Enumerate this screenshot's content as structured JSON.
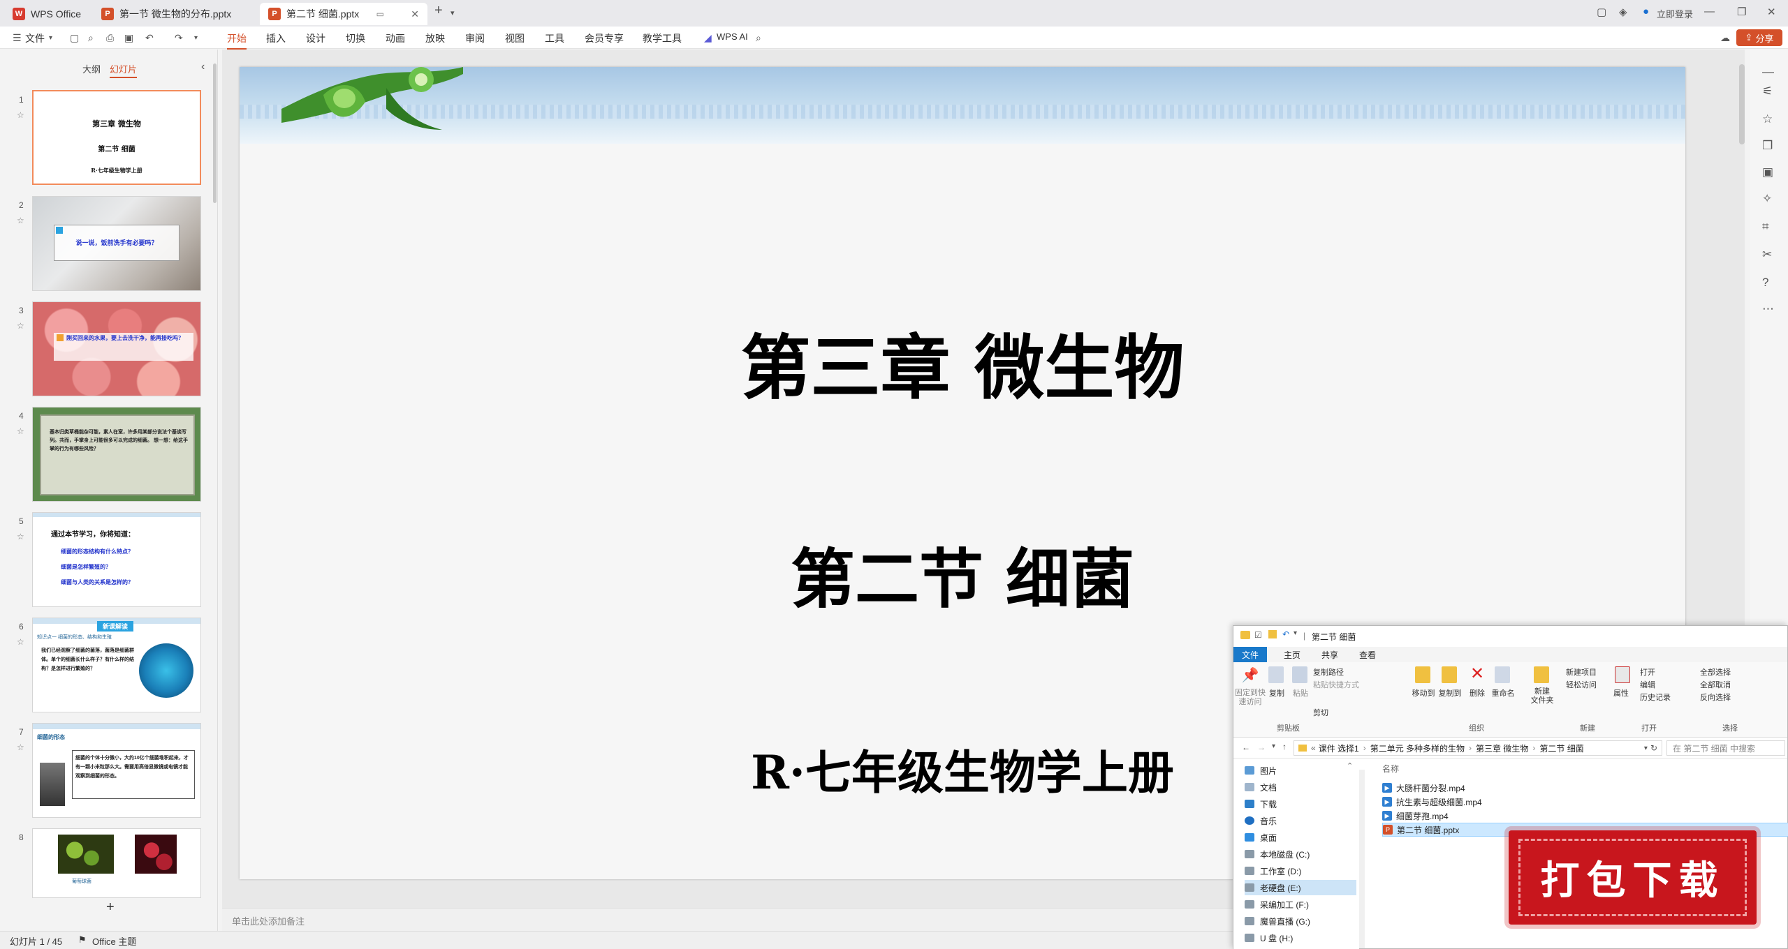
{
  "titlebar": {
    "tabs": [
      {
        "label": "WPS Office",
        "icon": "wps-logo-icon"
      },
      {
        "label": "第一节 微生物的分布.pptx",
        "icon": "pptx-icon"
      },
      {
        "label": "第二节 细菌.pptx",
        "icon": "pptx-icon"
      }
    ],
    "login": "立即登录"
  },
  "ribbon": {
    "file": "文件",
    "tabs": [
      "开始",
      "插入",
      "设计",
      "切换",
      "动画",
      "放映",
      "审阅",
      "视图",
      "工具",
      "会员专享",
      "教学工具"
    ],
    "ai": "WPS AI",
    "share": "分享"
  },
  "leftpanel": {
    "tab_outline": "大纲",
    "tab_slides": "幻灯片",
    "slides": [
      {
        "num": "1",
        "line1": "第三章  微生物",
        "line2": "第二节  细菌",
        "line3": "R·七年级生物学上册"
      },
      {
        "num": "2",
        "caption": "说一说，饭前洗手有必要吗？"
      },
      {
        "num": "3",
        "caption": "刚买回来的水果，要上去洗干净，能再接吃吗？"
      },
      {
        "num": "4",
        "caption": "基本归类草桶能杂可能，素人在室，许多用某部分说法个基谈写列。共而，手掌身上可能很多可以完成的细菌。 想一想：给这手掌的行为有哪些风险？"
      },
      {
        "num": "5",
        "heading": "通过本节学习，你将知道：",
        "items": [
          "细菌的形态结构有什么特点？",
          "细菌是怎样繁殖的？",
          "细菌与人类的关系是怎样的？"
        ]
      },
      {
        "num": "6",
        "banner": "新课解读",
        "subhead": "知识点一  细菌的形态、结构和生殖",
        "body": "我们已经观察了细菌的菌落，菌落是细菌群体。单个的细菌长什么样子？有什么样的结构？是怎样进行繁殖的？"
      },
      {
        "num": "7",
        "subhead": "细菌的形态",
        "body": "细菌的个体十分微小，大约10亿个细菌堆积起来，才有一颗小米粒那么大。需要用高倍显微镜或电镜才能观察到细菌的形态。"
      },
      {
        "num": "8",
        "caption": "葡萄球菌"
      }
    ],
    "add": "+"
  },
  "slide": {
    "title": "第三章  微生物",
    "subtitle": "第二节  细菌",
    "footer": "R·七年级生物学上册"
  },
  "notes": {
    "placeholder": "单击此处添加备注"
  },
  "status": {
    "slide_counter": "幻灯片 1 / 45",
    "theme": "Office 主题"
  },
  "explorer": {
    "title": "第二节 细菌",
    "tabs": [
      "文件",
      "主页",
      "共享",
      "查看"
    ],
    "ribbon": {
      "pin": "固定到快速访问",
      "copy": "复制",
      "paste": "粘贴",
      "copy_path": "复制路径",
      "paste_shortcut": "粘贴快捷方式",
      "cut": "剪切",
      "clipboard": "剪贴板",
      "move_to": "移动到",
      "copy_to": "复制到",
      "delete": "删除",
      "rename": "重命名",
      "organize": "组织",
      "new_folder": "新建\n文件夹",
      "new_item": "新建项目",
      "easy_access": "轻松访问",
      "new": "新建",
      "properties": "属性",
      "open": "打开",
      "edit": "编辑",
      "history": "历史记录",
      "open_group": "打开",
      "select_all": "全部选择",
      "select_none": "全部取消",
      "invert": "反向选择",
      "select": "选择"
    },
    "path": [
      "课件 选择1",
      "第二单元 多种多样的生物",
      "第三章 微生物",
      "第二节 细菌"
    ],
    "search_placeholder": "在 第二节 细菌 中搜索",
    "column_name": "名称",
    "nav": [
      "图片",
      "文档",
      "下载",
      "音乐",
      "桌面",
      "本地磁盘 (C:)",
      "工作室 (D:)",
      "老硬盘 (E:)",
      "采编加工 (F:)",
      "魔兽直播 (G:)",
      "U 盘 (H:)"
    ],
    "files": [
      {
        "name": "大肠杆菌分裂.mp4",
        "type": "video"
      },
      {
        "name": "抗生素与超级细菌.mp4",
        "type": "video"
      },
      {
        "name": "细菌芽孢.mp4",
        "type": "video"
      },
      {
        "name": "第二节 细菌.pptx",
        "type": "pptx"
      }
    ]
  },
  "stamp": {
    "label": "打包下载"
  },
  "colors": {
    "accent": "#d4502a",
    "wps_red": "#d73b2f",
    "explorer_blue": "#1979ca",
    "stamp_red": "#c8161d"
  }
}
